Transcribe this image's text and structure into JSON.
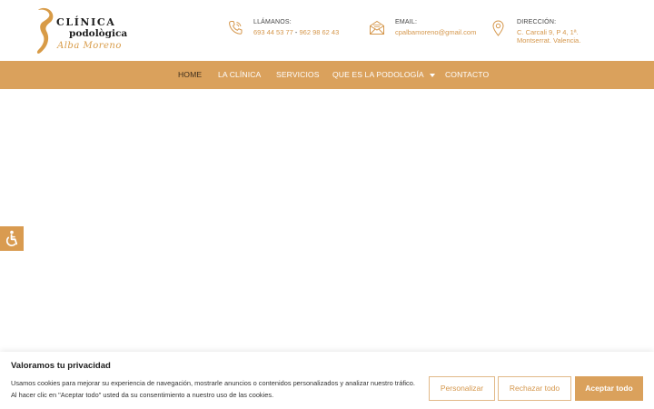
{
  "logo": {
    "line1": "CLÍNICA",
    "line2": "podològica",
    "line3": "Alba Moreno"
  },
  "contacts": {
    "phone": {
      "icon": "phone-icon",
      "label": "LLÁMANOS:",
      "number1": "693 44 53 77",
      "separator": "-",
      "number2": "962 98 62 43"
    },
    "email": {
      "icon": "mail-icon",
      "label": "EMAIL:",
      "value": "cpalbamoreno@gmail.com"
    },
    "address": {
      "icon": "map-pin-icon",
      "label": "DIRECCIÓN:",
      "line1": "C. Carcali 9, P 4, 1ª.",
      "line2": "Montserrat. Valencia."
    }
  },
  "nav": {
    "items": [
      {
        "label": "HOME",
        "active": true
      },
      {
        "label": "LA CLÍNICA"
      },
      {
        "label": "SERVICIOS"
      },
      {
        "label": "QUE ES LA PODOLOGÍA",
        "has_dropdown": true
      },
      {
        "label": "CONTACTO"
      }
    ]
  },
  "accessibility": {
    "icon": "accessibility-icon"
  },
  "cookie": {
    "title": "Valoramos tu privacidad",
    "text_line1": "Usamos cookies para mejorar su experiencia de navegación, mostrarle anuncios o contenidos personalizados y analizar nuestro tráfico.",
    "text_line2": "Al hacer clic en \"Aceptar todo\" usted da su consentimiento a nuestro uso de las cookies.",
    "customize_label": "Personalizar",
    "reject_label": "Rechazar todo",
    "accept_label": "Aceptar todo"
  },
  "colors": {
    "accent": "#daa15c",
    "accent_text": "#d5974c",
    "nav_active": "#3d2d1c"
  }
}
